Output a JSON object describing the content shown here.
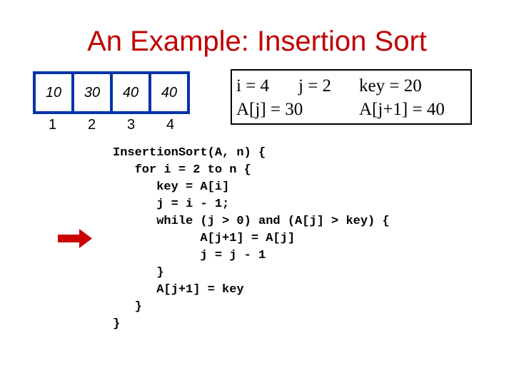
{
  "slide": {
    "title": "An Example: Insertion Sort"
  },
  "array": {
    "values": [
      "10",
      "30",
      "40",
      "40"
    ],
    "indices": [
      "1",
      "2",
      "3",
      "4"
    ],
    "border_color": "#0033aa"
  },
  "state": {
    "i": "i = 4",
    "j": "j = 2",
    "key": "key = 20",
    "a_j": "A[j] = 30",
    "a_j1": "A[j+1] = 40"
  },
  "code": {
    "lines": [
      "InsertionSort(A, n) {",
      "   for i = 2 to n {",
      "      key = A[i]",
      "      j = i - 1;",
      "      while (j > 0) and (A[j] > key) {",
      "            A[j+1] = A[j]",
      "            j = j - 1",
      "      }",
      "      A[j+1] = key",
      "   }",
      "}"
    ],
    "current_line_index": 5
  },
  "colors": {
    "title": "#c00000",
    "arrow": "#cc0000"
  }
}
